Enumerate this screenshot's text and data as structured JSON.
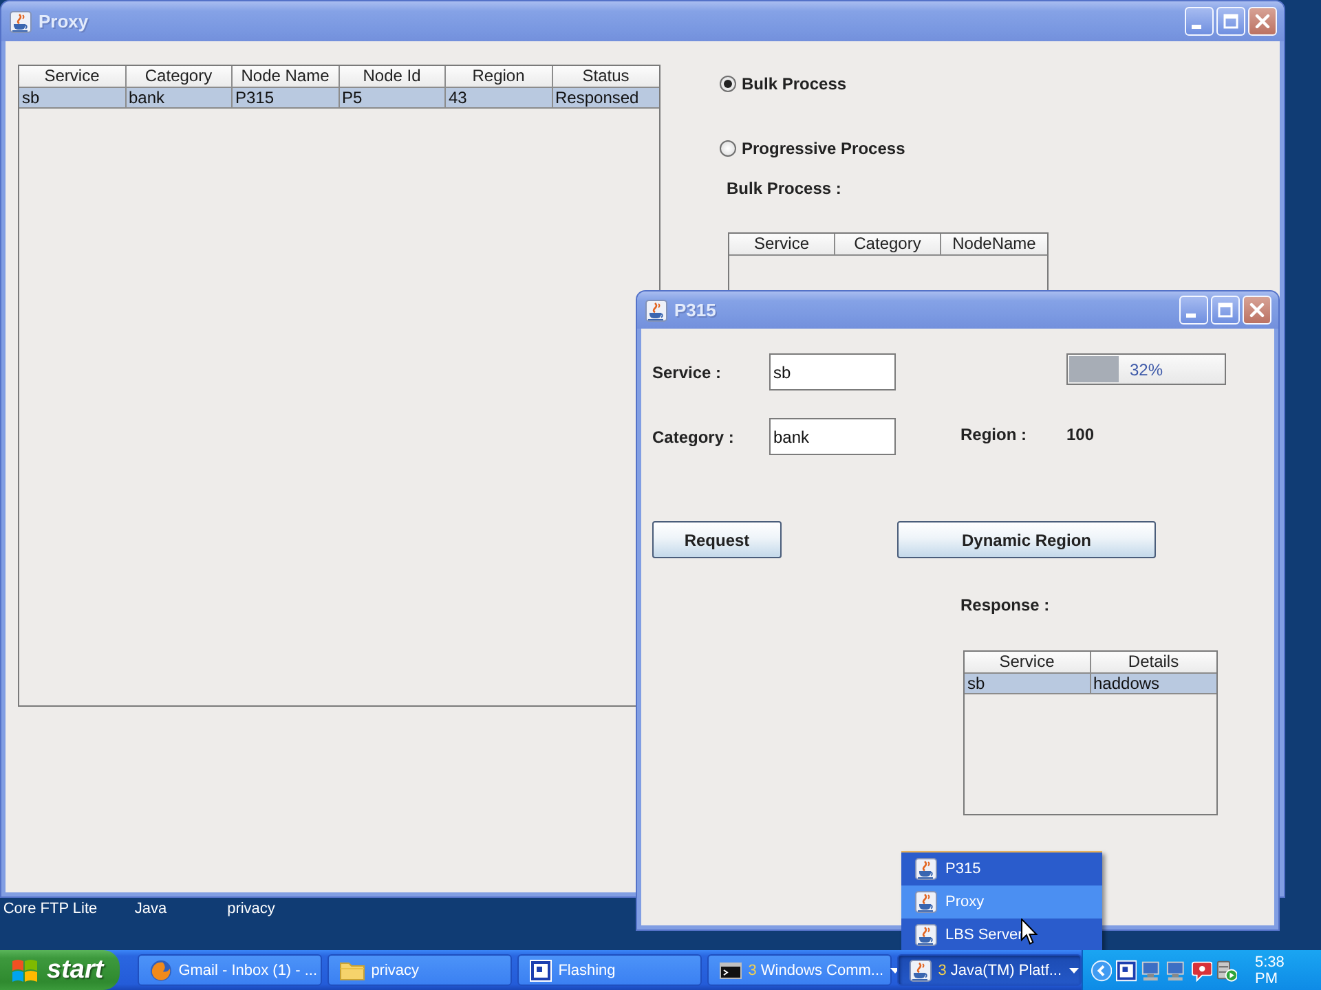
{
  "proxy_window": {
    "title": "Proxy",
    "nodes_table": {
      "columns": [
        "Service",
        "Category",
        "Node Name",
        "Node Id",
        "Region",
        "Status"
      ],
      "rows": [
        {
          "cells": [
            "sb",
            "bank",
            "P315",
            "P5",
            "43",
            "Responsed"
          ],
          "selected": true
        }
      ]
    },
    "process_options": [
      {
        "label": "Bulk Process",
        "selected": true
      },
      {
        "label": "Progressive Process",
        "selected": false
      }
    ],
    "bulk_label": "Bulk Process :",
    "bulk_table": {
      "columns": [
        "Service",
        "Category",
        "NodeName"
      ]
    }
  },
  "node_window": {
    "title": "P315",
    "fields": [
      {
        "label": "Service :",
        "value": "sb"
      },
      {
        "label": "Category :",
        "value": "bank"
      }
    ],
    "progress": {
      "level": 0.32,
      "reading": "32%"
    },
    "region": {
      "label": "Region :",
      "value": "100"
    },
    "buttons": [
      "Request",
      "Dynamic Region"
    ],
    "response_label": "Response :",
    "response_table": {
      "columns": [
        "Service",
        "Details"
      ],
      "rows": [
        {
          "cells": [
            "sb",
            "haddows"
          ],
          "selected": true
        }
      ]
    }
  },
  "desktop_labels": [
    "Core FTP Lite",
    "Java",
    "privacy"
  ],
  "group_menu": [
    {
      "label": "P315",
      "selected": false
    },
    {
      "label": "Proxy",
      "selected": true
    },
    {
      "label": "LBS Server",
      "selected": false
    }
  ],
  "taskbar": {
    "start": "start",
    "tasks": [
      {
        "kind": "single",
        "label": "Gmail - Inbox (1) - ...",
        "selected": false
      },
      {
        "kind": "single",
        "label": "privacy",
        "selected": false
      },
      {
        "kind": "single",
        "label": "Flashing",
        "selected": false
      },
      {
        "kind": "group",
        "count": "3",
        "label": "Windows Comm...",
        "selected": false
      },
      {
        "kind": "group",
        "count": "3",
        "label": "Java(TM) Platf...",
        "selected": true
      }
    ],
    "clock": "5:38 PM"
  }
}
